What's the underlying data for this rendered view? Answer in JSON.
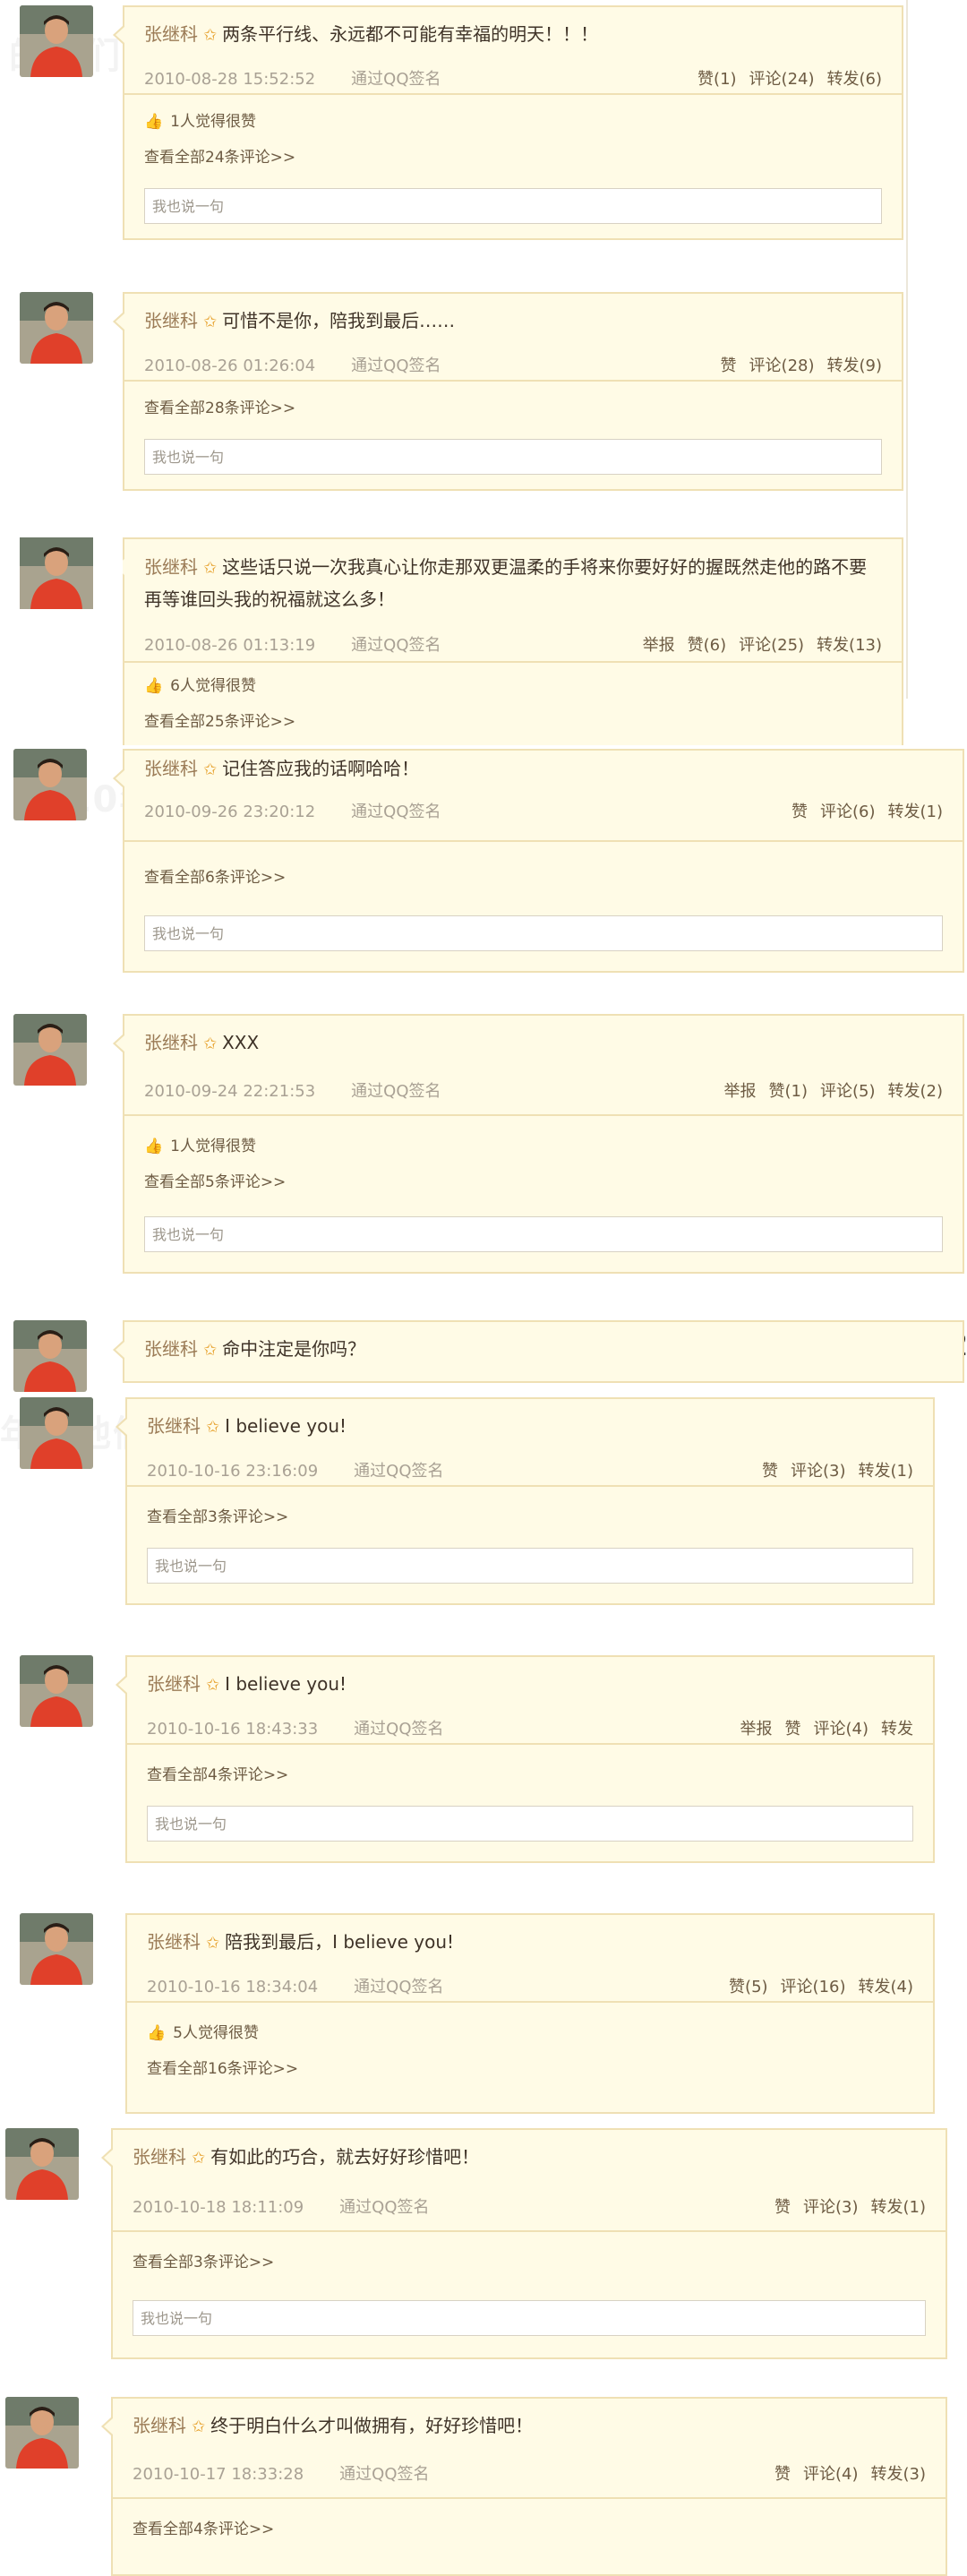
{
  "avatar_alt": "张继科",
  "watermarks": {
    "wm1": "的他们",
    "wm2": "2010年的他们",
    "wm3": "年的他们"
  },
  "edge_glyph": "2",
  "reply_placeholder": "我也说一句",
  "posts": [
    {
      "user": "张继科",
      "text": "两条平行线、永远都不可能有幸福的明天！！！",
      "time": "2010-08-28 15:52:52",
      "via": "通过QQ签名",
      "report": "",
      "like": "赞(1)",
      "comment": "评论(24)",
      "forward": "转发(6)",
      "likes_text": "1人觉得很赞",
      "view_all": "查看全部24条评论>>"
    },
    {
      "user": "张继科",
      "text": "可惜不是你，陪我到最后……",
      "time": "2010-08-26 01:26:04",
      "via": "通过QQ签名",
      "report": "",
      "like": "赞",
      "comment": "评论(28)",
      "forward": "转发(9)",
      "likes_text": "",
      "view_all": "查看全部28条评论>>"
    },
    {
      "user": "张继科",
      "text": "这些话只说一次我真心让你走那双更温柔的手将来你要好好的握既然走他的路不要再等谁回头我的祝福就这么多！",
      "time": "2010-08-26 01:13:19",
      "via": "通过QQ签名",
      "report": "举报",
      "like": "赞(6)",
      "comment": "评论(25)",
      "forward": "转发(13)",
      "likes_text": "6人觉得很赞",
      "view_all": "查看全部25条评论>>"
    },
    {
      "user": "张继科",
      "text": "记住答应我的话啊哈哈！",
      "time": "2010-09-26 23:20:12",
      "via": "通过QQ签名",
      "report": "",
      "like": "赞",
      "comment": "评论(6)",
      "forward": "转发(1)",
      "likes_text": "",
      "view_all": "查看全部6条评论>>"
    },
    {
      "user": "张继科",
      "text": "XXX",
      "time": "2010-09-24 22:21:53",
      "via": "通过QQ签名",
      "report": "举报",
      "like": "赞(1)",
      "comment": "评论(5)",
      "forward": "转发(2)",
      "likes_text": "1人觉得很赞",
      "view_all": "查看全部5条评论>>"
    },
    {
      "user": "张继科",
      "text": "命中注定是你吗？"
    },
    {
      "user": "张继科",
      "text": "I believe you!",
      "time": "2010-10-16 23:16:09",
      "via": "通过QQ签名",
      "report": "",
      "like": "赞",
      "comment": "评论(3)",
      "forward": "转发(1)",
      "likes_text": "",
      "view_all": "查看全部3条评论>>"
    },
    {
      "user": "张继科",
      "text": "I believe you!",
      "time": "2010-10-16 18:43:33",
      "via": "通过QQ签名",
      "report": "举报",
      "like": "赞",
      "comment": "评论(4)",
      "forward": "转发",
      "likes_text": "",
      "view_all": "查看全部4条评论>>"
    },
    {
      "user": "张继科",
      "text": "陪我到最后，I believe you!",
      "time": "2010-10-16 18:34:04",
      "via": "通过QQ签名",
      "report": "",
      "like": "赞(5)",
      "comment": "评论(16)",
      "forward": "转发(4)",
      "likes_text": "5人觉得很赞",
      "view_all": "查看全部16条评论>>"
    },
    {
      "user": "张继科",
      "text": "有如此的巧合，就去好好珍惜吧！",
      "time": "2010-10-18 18:11:09",
      "via": "通过QQ签名",
      "report": "",
      "like": "赞",
      "comment": "评论(3)",
      "forward": "转发(1)",
      "likes_text": "",
      "view_all": "查看全部3条评论>>"
    },
    {
      "user": "张继科",
      "text": "终于明白什么才叫做拥有，好好珍惜吧！",
      "time": "2010-10-17 18:33:28",
      "via": "通过QQ签名",
      "report": "",
      "like": "赞",
      "comment": "评论(4)",
      "forward": "转发(3)",
      "likes_text": "",
      "view_all": "查看全部4条评论>>"
    }
  ]
}
